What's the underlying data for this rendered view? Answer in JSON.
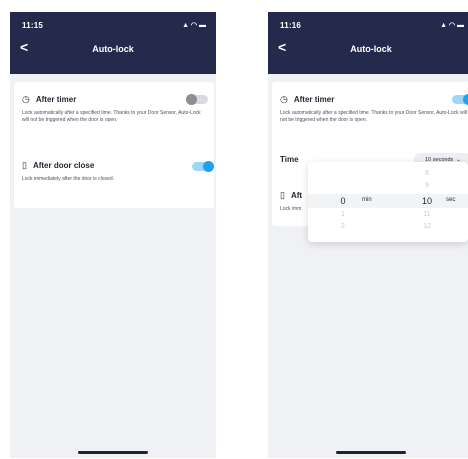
{
  "left": {
    "status_time": "11:15",
    "status_icons": "▲ ◠ ▬",
    "back_label": "<",
    "title": "Auto-lock",
    "after_timer": {
      "label": "After timer",
      "icon": "clock-icon",
      "description": "Lock automatically after a specified time. Thanks to your Door Sensor, Auto-Lock will not be triggered when the door is open.",
      "enabled": false
    },
    "after_door_close": {
      "label": "After door close",
      "icon": "door-icon",
      "description": "Lock immediately after the door is closed.",
      "enabled": true
    }
  },
  "right": {
    "status_time": "11:16",
    "status_icons": "▲ ◠ ▬",
    "back_label": "<",
    "title": "Auto-lock",
    "after_timer": {
      "label": "After timer",
      "icon": "clock-icon",
      "description": "Lock automatically after a specified time. Thanks to your Door Sensor, Auto-Lock will not be triggered when the door is open.",
      "enabled": true
    },
    "time": {
      "label": "Time",
      "value": "10 seconds",
      "chevron": "⌄"
    },
    "after_door_close": {
      "label_partial": "Aft",
      "icon": "door-icon",
      "description_partial": "Lock imm"
    },
    "picker": {
      "minutes": {
        "above": "",
        "selected": "0",
        "below1": "1",
        "below2": "2",
        "unit": "min"
      },
      "seconds": {
        "above2": "8",
        "above1": "9",
        "selected": "10",
        "below1": "11",
        "below2": "12",
        "unit": "sec"
      }
    }
  },
  "colors": {
    "header": "#232a4c",
    "accent": "#1fa2ef",
    "background": "#f0f1f5"
  }
}
